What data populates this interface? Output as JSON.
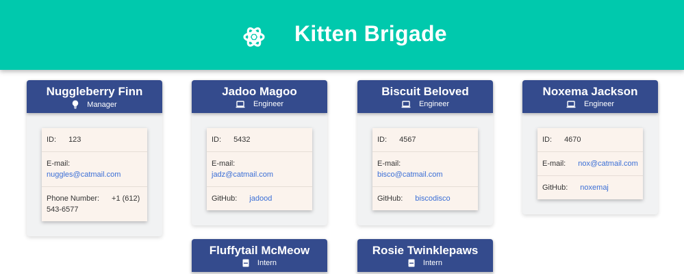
{
  "header": {
    "title": "Kitten Brigade",
    "logo_icon": "atom-icon"
  },
  "labels": {
    "id": "ID:",
    "email": "E-mail:",
    "github": "GitHub:",
    "phone": "Phone Number:"
  },
  "employees": [
    {
      "name": "Nuggleberry Finn",
      "role": "Manager",
      "role_icon": "lightbulb-icon",
      "id": "123",
      "email": "nuggles@catmail.com",
      "phone": "+1 (612)",
      "phone_cont": "543-6577"
    },
    {
      "name": "Jadoo Magoo",
      "role": "Engineer",
      "role_icon": "laptop-icon",
      "id": "5432",
      "email": "jadz@catmail.com",
      "github": "jadood"
    },
    {
      "name": "Biscuit Beloved",
      "role": "Engineer",
      "role_icon": "laptop-icon",
      "id": "4567",
      "email": "bisco@catmail.com",
      "github": "biscodisco"
    },
    {
      "name": "Noxema Jackson",
      "role": "Engineer",
      "role_icon": "laptop-icon",
      "id": "4670",
      "email": "nox@catmail.com",
      "github": "noxemaj"
    },
    {
      "name": "Fluffytail McMeow",
      "role": "Intern",
      "role_icon": "school-icon"
    },
    {
      "name": "Rosie Twinklepaws",
      "role": "Intern",
      "role_icon": "school-icon"
    }
  ],
  "colors": {
    "banner": "#00c9ad",
    "card_header": "#344b8d",
    "info_bg": "#fbf3ed",
    "link": "#3a6ed6"
  }
}
